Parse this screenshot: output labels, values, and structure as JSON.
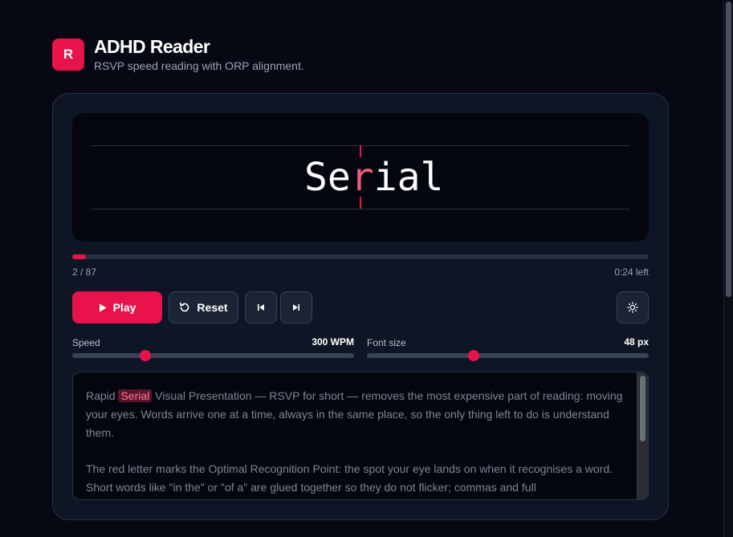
{
  "app": {
    "logo_letter": "R",
    "title": "ADHD Reader",
    "subtitle": "RSVP speed reading with ORP alignment."
  },
  "reader": {
    "word_before": "Se",
    "word_orp": "r",
    "word_after": "ial"
  },
  "progress": {
    "count": "2 / 87",
    "time_left": "0:24 left",
    "fraction": 0.023
  },
  "controls": {
    "play_label": "Play",
    "reset_label": "Reset",
    "prev_icon": "skip-back-icon",
    "next_icon": "skip-forward-icon",
    "theme_icon": "sun-icon"
  },
  "speed": {
    "label": "Speed",
    "value_text": "300 WPM",
    "fraction": 0.26
  },
  "font_size": {
    "label": "Font size",
    "value_text": "48 px",
    "fraction": 0.38
  },
  "source_text": {
    "p1_before": "Rapid ",
    "p1_highlight": "Serial",
    "p1_after": " Visual Presentation — RSVP for short — removes the most expensive part of reading: moving your eyes. Words arrive one at a time, always in the same place, so the only thing left to do is understand them.",
    "p2": "The red letter marks the Optimal Recognition Point: the spot your eye lands on when it recognises a word. Short words like \"in the\" or \"of a\" are glued together so they do not flicker; commas and full"
  },
  "colors": {
    "accent": "#e8134a",
    "background": "#060914",
    "card": "#0e1524"
  }
}
